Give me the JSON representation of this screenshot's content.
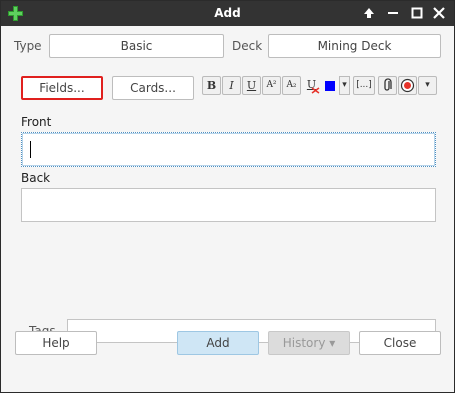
{
  "window": {
    "title": "Add"
  },
  "type_row": {
    "type_label": "Type",
    "type_value": "Basic",
    "deck_label": "Deck",
    "deck_value": "Mining Deck"
  },
  "toolbar": {
    "fields_label": "Fields...",
    "cards_label": "Cards...",
    "bold": "B",
    "italic": "I",
    "underline": "U",
    "superscript": "A²",
    "subscript": "A₂",
    "clear_format": "U",
    "color_dropdown": "▾",
    "cloze": "[...]",
    "attach": "📎",
    "record": "●",
    "more": "▾",
    "text_color": "#0000ff",
    "highlight_color": "#e6332a"
  },
  "fields": [
    {
      "label": "Front",
      "value": ""
    },
    {
      "label": "Back",
      "value": ""
    }
  ],
  "tags": {
    "label": "Tags",
    "value": ""
  },
  "buttons": {
    "help": "Help",
    "add": "Add",
    "history": "History ▾",
    "close": "Close"
  }
}
